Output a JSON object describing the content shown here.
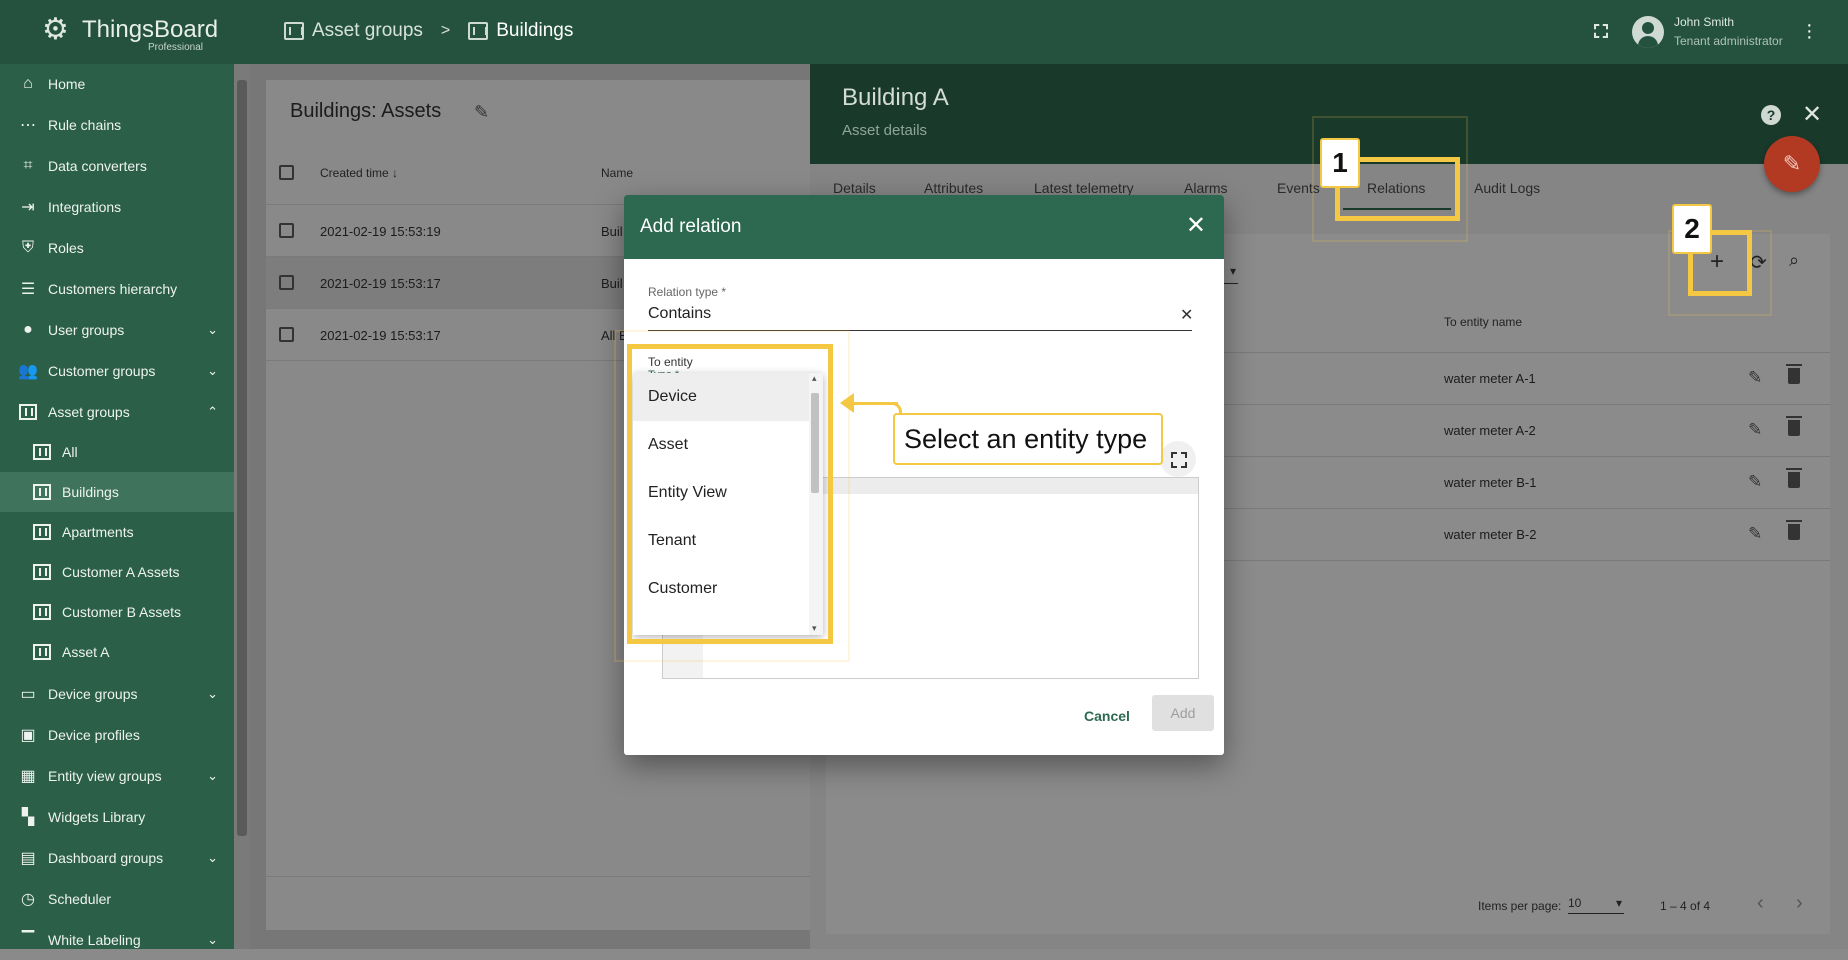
{
  "app": {
    "brand": "ThingsBoard",
    "edition": "Professional"
  },
  "breadcrumb": {
    "parent": "Asset groups",
    "separator": ">",
    "current": "Buildings"
  },
  "user": {
    "name": "John Smith",
    "role": "Tenant administrator"
  },
  "sidebar": {
    "items": [
      {
        "label": "Home",
        "icon": "home-icon"
      },
      {
        "label": "Rule chains",
        "icon": "rule-chain-icon"
      },
      {
        "label": "Data converters",
        "icon": "converter-icon"
      },
      {
        "label": "Integrations",
        "icon": "integration-icon"
      },
      {
        "label": "Roles",
        "icon": "shield-icon"
      },
      {
        "label": "Customers hierarchy",
        "icon": "hierarchy-icon"
      },
      {
        "label": "User groups",
        "icon": "account-icon"
      },
      {
        "label": "Customer groups",
        "icon": "people-icon"
      },
      {
        "label": "Asset groups",
        "icon": "building-icon"
      },
      {
        "label": "All",
        "icon": "building-icon"
      },
      {
        "label": "Buildings",
        "icon": "building-icon"
      },
      {
        "label": "Apartments",
        "icon": "building-icon"
      },
      {
        "label": "Customer A Assets",
        "icon": "building-icon"
      },
      {
        "label": "Customer B Assets",
        "icon": "building-icon"
      },
      {
        "label": "Asset A",
        "icon": "building-icon"
      },
      {
        "label": "Device groups",
        "icon": "devices-icon"
      },
      {
        "label": "Device profiles",
        "icon": "device-profile-icon"
      },
      {
        "label": "Entity view groups",
        "icon": "view-icon"
      },
      {
        "label": "Widgets Library",
        "icon": "widgets-icon"
      },
      {
        "label": "Dashboard groups",
        "icon": "dashboard-icon"
      },
      {
        "label": "Scheduler",
        "icon": "clock-icon"
      },
      {
        "label": "White Labeling",
        "icon": "paint-roller-icon"
      }
    ]
  },
  "assets_table": {
    "title": "Buildings: Assets",
    "columns": [
      "Created time",
      "Name"
    ],
    "rows": [
      {
        "created": "2021-02-19 15:53:19",
        "name": "Buil"
      },
      {
        "created": "2021-02-19 15:53:17",
        "name": "Buil"
      },
      {
        "created": "2021-02-19 15:53:17",
        "name": "All B"
      }
    ]
  },
  "detail": {
    "title": "Building A",
    "subtitle": "Asset details",
    "tabs": [
      "Details",
      "Attributes",
      "Latest telemetry",
      "Alarms",
      "Events",
      "Relations",
      "Audit Logs"
    ]
  },
  "relations": {
    "column": "To entity name",
    "rows": [
      "water meter A-1",
      "water meter A-2",
      "water meter B-1",
      "water meter B-2"
    ],
    "pager": {
      "label": "Items per page:",
      "page_size": "10",
      "range": "1 – 4 of 4"
    }
  },
  "dialog": {
    "title": "Add relation",
    "relation_type_label": "Relation type *",
    "relation_type_value": "Contains",
    "to_entity_label": "To entity",
    "to_entity_type_label": "Type *",
    "cancel": "Cancel",
    "add": "Add"
  },
  "entity_type_dropdown": {
    "options": [
      "Device",
      "Asset",
      "Entity View",
      "Tenant",
      "Customer"
    ],
    "highlighted": "Device"
  },
  "annotations": {
    "callout": "Select an entity type",
    "badge_1": "1",
    "badge_2": "2",
    "highlight_color": "#f4c842"
  },
  "colors": {
    "primary": "#2d6850",
    "fab": "#b23a22"
  }
}
